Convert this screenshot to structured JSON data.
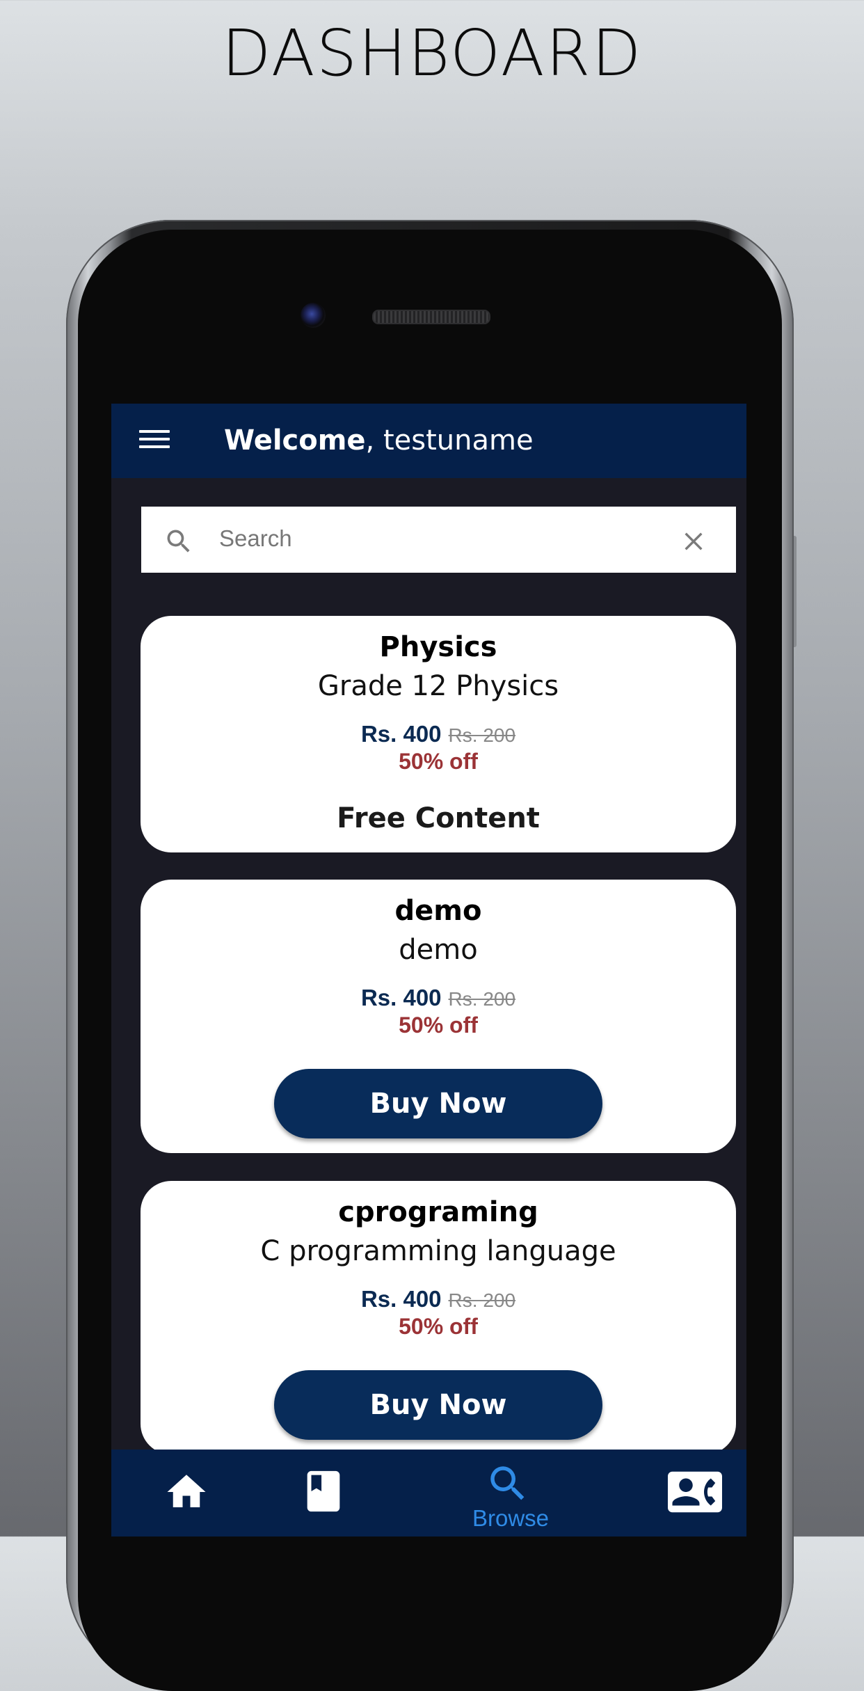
{
  "page": {
    "headline": "DASHBOARD"
  },
  "header": {
    "welcome_bold": "Welcome",
    "welcome_rest": ", testuname"
  },
  "search": {
    "placeholder": "Search"
  },
  "courses": [
    {
      "title": "Physics",
      "subtitle": "Grade 12 Physics",
      "price": "Rs. 400",
      "old_price": "Rs. 200",
      "discount": "50% off",
      "action": "Free Content"
    },
    {
      "title": "demo",
      "subtitle": "demo",
      "price": "Rs. 400",
      "old_price": "Rs. 200",
      "discount": "50% off",
      "action": "Buy Now"
    },
    {
      "title": "cprograming",
      "subtitle": "C programming language",
      "price": "Rs. 400",
      "old_price": "Rs. 200",
      "discount": "50% off",
      "action": "Buy Now"
    }
  ],
  "bottom_nav": {
    "items": [
      {
        "icon": "home-icon",
        "label": ""
      },
      {
        "icon": "book-icon",
        "label": ""
      },
      {
        "icon": "search-icon",
        "label": "Browse",
        "active": true
      },
      {
        "icon": "contact-card-icon",
        "label": ""
      }
    ]
  },
  "colors": {
    "primary": "#05204a",
    "button": "#082c5a",
    "price": "#0b2a52",
    "discount": "#9b3336",
    "active_nav": "#2f8be6"
  }
}
